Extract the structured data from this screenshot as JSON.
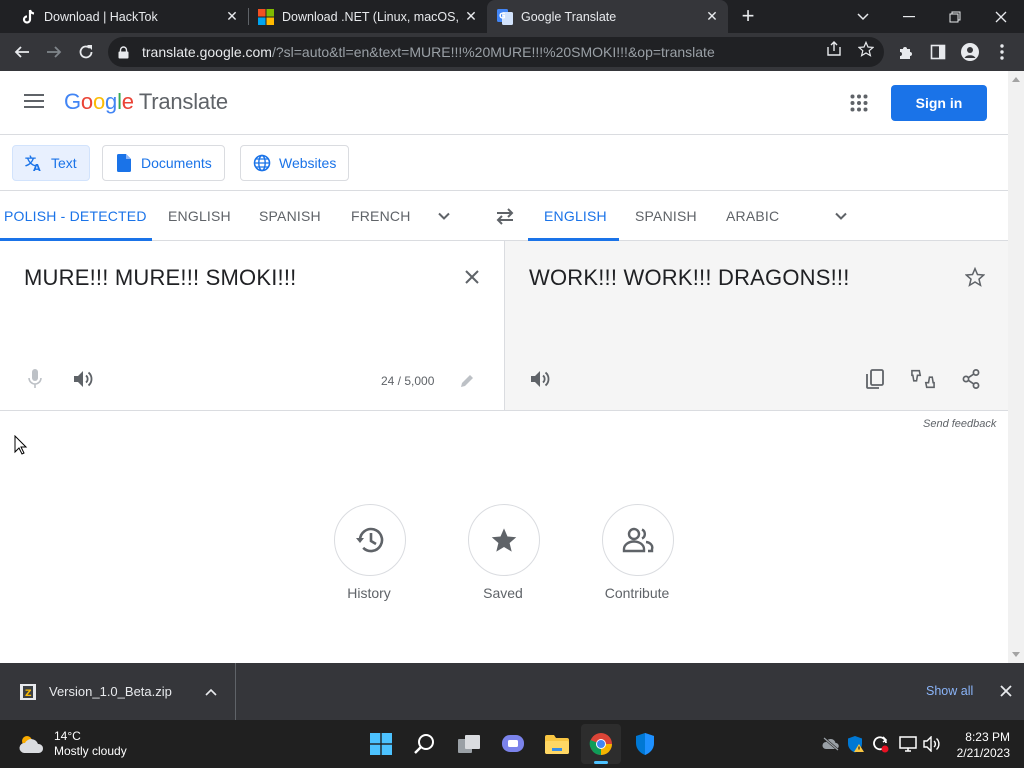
{
  "browser": {
    "tabs": [
      {
        "title": "Download | HackTok",
        "active": false
      },
      {
        "title": "Download .NET (Linux, macOS, ar",
        "active": false
      },
      {
        "title": "Google Translate",
        "active": true
      }
    ],
    "address": {
      "host": "translate.google.com",
      "path": "/?sl=auto&tl=en&text=MURE!!!%20MURE!!!%20SMOKI!!!&op=translate"
    }
  },
  "header": {
    "logo_letters": [
      "G",
      "o",
      "o",
      "g",
      "l",
      "e"
    ],
    "product": "Translate",
    "sign_in": "Sign in"
  },
  "modes": [
    {
      "label": "Text",
      "icon": "translate-icon",
      "selected": true
    },
    {
      "label": "Documents",
      "icon": "document-icon",
      "selected": false
    },
    {
      "label": "Websites",
      "icon": "globe-icon",
      "selected": false
    }
  ],
  "source_langs": [
    "POLISH - DETECTED",
    "ENGLISH",
    "SPANISH",
    "FRENCH"
  ],
  "target_langs": [
    "ENGLISH",
    "SPANISH",
    "ARABIC"
  ],
  "source": {
    "text": "MURE!!! MURE!!! SMOKI!!!",
    "char_count": "24 / 5,000"
  },
  "target": {
    "text": "WORK!!! WORK!!! DRAGONS!!!"
  },
  "feedback": "Send feedback",
  "shortcuts": [
    {
      "label": "History",
      "icon": "history-icon"
    },
    {
      "label": "Saved",
      "icon": "star-icon"
    },
    {
      "label": "Contribute",
      "icon": "people-icon"
    }
  ],
  "download_shelf": {
    "file": "Version_1.0_Beta.zip",
    "show_all": "Show all"
  },
  "taskbar": {
    "weather_temp": "14°C",
    "weather_desc": "Mostly cloudy",
    "time": "8:23 PM",
    "date": "2/21/2023"
  },
  "colors": {
    "accent": "#1a73e8",
    "chrome_dark": "#202124",
    "chrome_toolbar": "#35363a"
  }
}
